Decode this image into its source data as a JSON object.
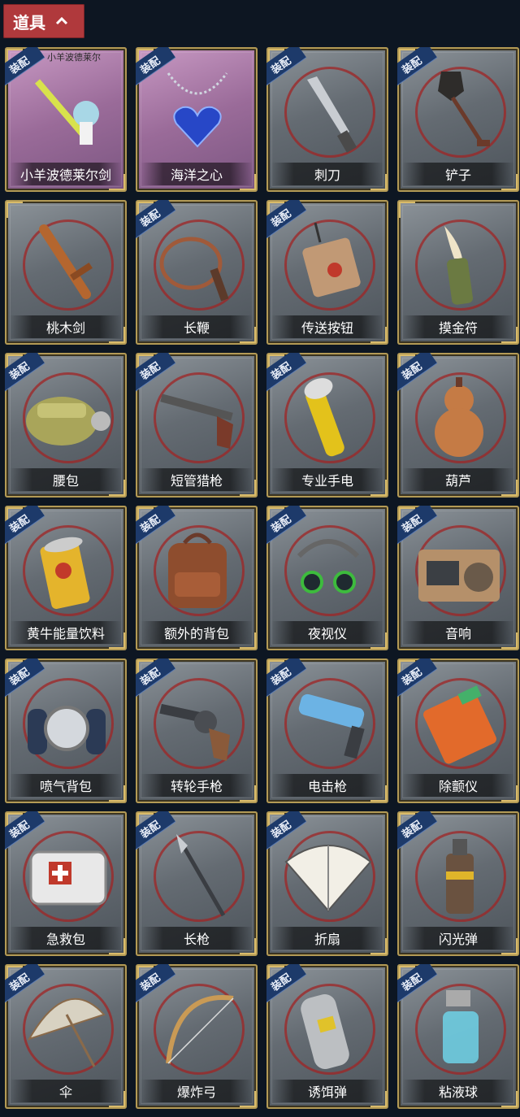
{
  "header": {
    "title": "道具",
    "chevron_icon": "chevron-up-icon",
    "accent": "#b0393c"
  },
  "equip_tag_label": "装配",
  "items": [
    {
      "name": "小羊波德莱尔剑",
      "equipped": true,
      "special": true,
      "icon": "sword-figure-icon",
      "watermark": "小羊波德莱尔"
    },
    {
      "name": "海洋之心",
      "equipped": true,
      "special": true,
      "icon": "heart-necklace-icon"
    },
    {
      "name": "刺刀",
      "equipped": true,
      "icon": "bayonet-icon"
    },
    {
      "name": "铲子",
      "equipped": true,
      "icon": "shovel-icon"
    },
    {
      "name": "桃木剑",
      "equipped": false,
      "icon": "wooden-sword-icon"
    },
    {
      "name": "长鞭",
      "equipped": true,
      "icon": "whip-icon"
    },
    {
      "name": "传送按钮",
      "equipped": true,
      "icon": "teleport-button-icon"
    },
    {
      "name": "摸金符",
      "equipped": false,
      "icon": "talisman-icon"
    },
    {
      "name": "腰包",
      "equipped": true,
      "icon": "waist-bag-icon"
    },
    {
      "name": "短管猎枪",
      "equipped": true,
      "icon": "shotgun-icon"
    },
    {
      "name": "专业手电",
      "equipped": true,
      "icon": "flashlight-icon"
    },
    {
      "name": "葫芦",
      "equipped": true,
      "icon": "gourd-icon"
    },
    {
      "name": "黄牛能量饮料",
      "equipped": true,
      "icon": "energy-drink-icon"
    },
    {
      "name": "额外的背包",
      "equipped": true,
      "icon": "backpack-icon"
    },
    {
      "name": "夜视仪",
      "equipped": true,
      "icon": "night-vision-icon"
    },
    {
      "name": "音响",
      "equipped": true,
      "icon": "boombox-icon"
    },
    {
      "name": "喷气背包",
      "equipped": true,
      "icon": "jetpack-icon"
    },
    {
      "name": "转轮手枪",
      "equipped": true,
      "icon": "revolver-icon"
    },
    {
      "name": "电击枪",
      "equipped": true,
      "icon": "shock-gun-icon"
    },
    {
      "name": "除颤仪",
      "equipped": true,
      "icon": "defibrillator-icon"
    },
    {
      "name": "急救包",
      "equipped": true,
      "icon": "first-aid-kit-icon"
    },
    {
      "name": "长枪",
      "equipped": true,
      "icon": "spear-icon"
    },
    {
      "name": "折扇",
      "equipped": true,
      "icon": "folding-fan-icon"
    },
    {
      "name": "闪光弹",
      "equipped": true,
      "icon": "flash-grenade-icon"
    },
    {
      "name": "伞",
      "equipped": true,
      "icon": "umbrella-icon"
    },
    {
      "name": "爆炸弓",
      "equipped": true,
      "icon": "bow-icon"
    },
    {
      "name": "诱饵弹",
      "equipped": true,
      "icon": "decoy-grenade-icon"
    },
    {
      "name": "粘液球",
      "equipped": true,
      "icon": "slime-ball-icon"
    }
  ]
}
